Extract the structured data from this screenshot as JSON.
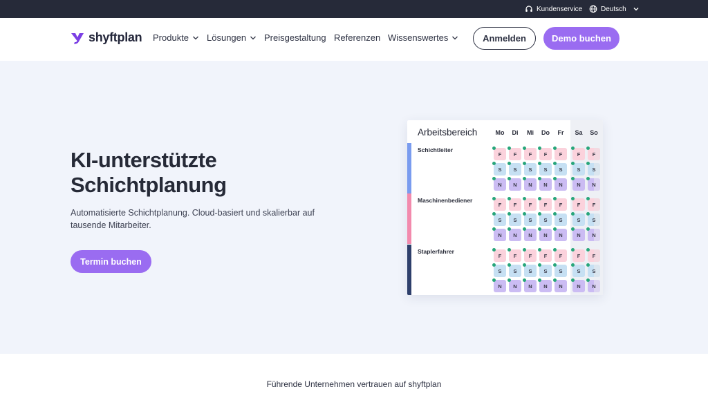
{
  "topbar": {
    "service_label": "Kundenservice",
    "service_icon": "headset-icon",
    "language_label": "Deutsch",
    "language_icon": "globe-icon"
  },
  "nav": {
    "logo_text": "shyftplan",
    "menu": [
      {
        "label": "Produkte",
        "has_dropdown": true
      },
      {
        "label": "Lösungen",
        "has_dropdown": true
      },
      {
        "label": "Preisgestaltung",
        "has_dropdown": false
      },
      {
        "label": "Referenzen",
        "has_dropdown": false
      },
      {
        "label": "Wissenswertes",
        "has_dropdown": true
      }
    ],
    "login_label": "Anmelden",
    "demo_label": "Demo buchen"
  },
  "hero": {
    "headline_line1": "KI-unterstützte",
    "headline_line2": "Schichtplanung",
    "subtext": "Automatisierte Schichtplanung. Cloud-basiert und skalierbar auf tausende Mitarbeiter.",
    "cta_label": "Termin buchen"
  },
  "schedule": {
    "title": "Arbeitsbereich",
    "days": [
      "Mo",
      "Di",
      "Mi",
      "Do",
      "Fr",
      "Sa",
      "So"
    ],
    "shifts": [
      "F",
      "S",
      "N"
    ],
    "groups": [
      {
        "name": "Schichtleiter",
        "color": "#7a9cef"
      },
      {
        "name": "Maschinenbediener",
        "color": "#f28aad"
      },
      {
        "name": "Staplerfahrer",
        "color": "#2e3f6b"
      }
    ]
  },
  "trust_text": "Führende Unternehmen vertrauen auf shyftplan",
  "colors": {
    "accent": "#9a6cf1",
    "topbar": "#262a39",
    "hero_bg": "#f1f4fb"
  }
}
